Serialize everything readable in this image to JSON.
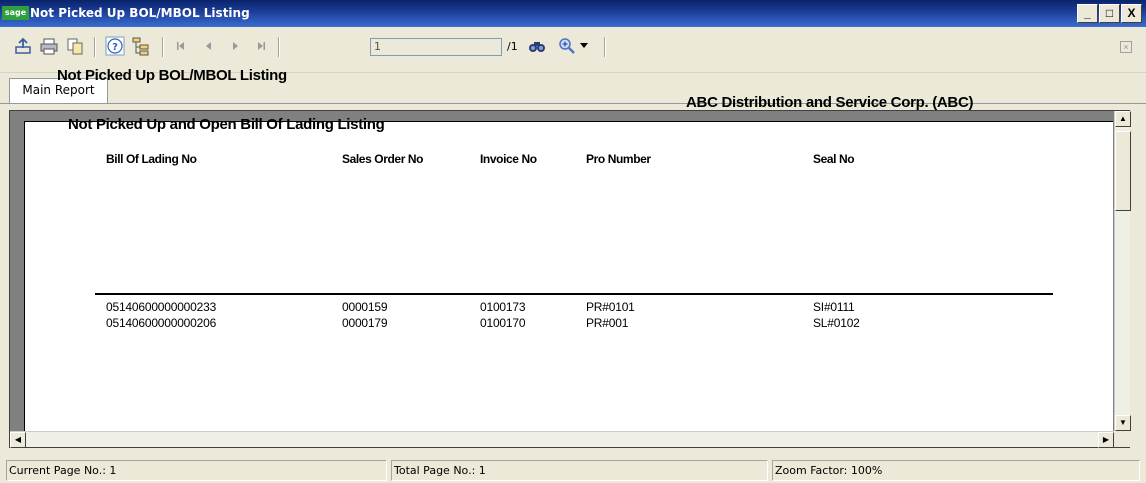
{
  "window": {
    "logo_text": "sage",
    "title": "Not Picked Up BOL/MBOL Listing",
    "minimize": "_",
    "maximize": "□",
    "close": "X"
  },
  "toolbar": {
    "page_input_value": "1",
    "page_total": "/1",
    "close_label": "×",
    "icons": [
      "export-icon",
      "print-icon",
      "copy-icon",
      "help-icon",
      "group-tree-icon",
      "first-page-icon",
      "previous-page-icon",
      "next-page-icon",
      "last-page-icon",
      "search-icon",
      "zoom-icon"
    ]
  },
  "tabs": [
    {
      "label": "Main Report"
    }
  ],
  "report": {
    "title": "Not Picked Up BOL/MBOL Listing",
    "company": "ABC Distribution and Service Corp. (ABC)",
    "subtitle": "Not Picked Up and Open Bill Of Lading Listing",
    "columns": [
      "Bill Of Lading No",
      "Sales Order No",
      "Invoice No",
      "Pro Number",
      "Seal No"
    ],
    "rows": [
      [
        "05140600000000233",
        "0000159",
        "0100173",
        "PR#0101",
        "SI#0111"
      ],
      [
        "05140600000000206",
        "0000179",
        "0100170",
        "PR#001",
        "SL#0102"
      ]
    ]
  },
  "status": {
    "current_page": "Current Page No.: 1",
    "total_page": "Total Page No.: 1",
    "zoom": "Zoom Factor: 100%"
  }
}
